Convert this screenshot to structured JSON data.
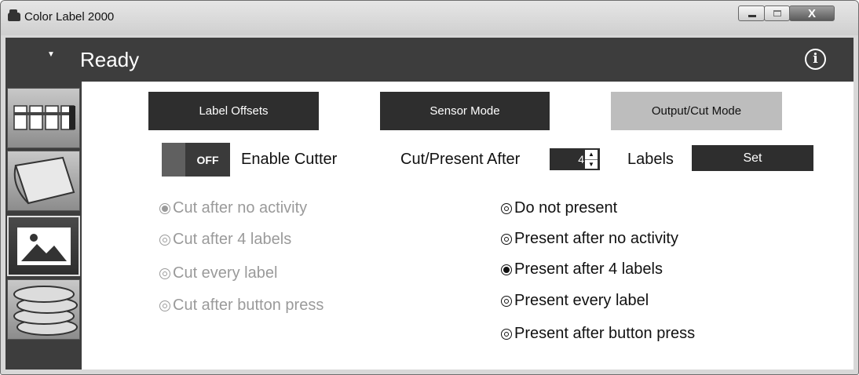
{
  "window": {
    "title": "Color Label 2000",
    "close_glyph": "X"
  },
  "status": {
    "text": "Ready",
    "info_icon": "info-icon"
  },
  "sidebar": {
    "tabs": [
      "printer-cartridge-icon",
      "roll-media-icon",
      "image-icon",
      "coins-icon"
    ]
  },
  "tabs": [
    {
      "label": "Label Offsets"
    },
    {
      "label": "Sensor Mode"
    },
    {
      "label": "Output/Cut Mode"
    }
  ],
  "cutter": {
    "toggle_state": "OFF",
    "label": "Enable Cutter"
  },
  "cut_present": {
    "label": "Cut/Present After",
    "count": "4",
    "unit_label": "Labels",
    "set_label": "Set"
  },
  "cut_options": [
    {
      "label": "Cut after no activity",
      "selected": true
    },
    {
      "label": "Cut after 4 labels",
      "selected": false
    },
    {
      "label": "Cut every label",
      "selected": false
    },
    {
      "label": "Cut after button press",
      "selected": false
    }
  ],
  "present_options": [
    {
      "label": "Do not present",
      "selected": false
    },
    {
      "label": "Present after no activity",
      "selected": false
    },
    {
      "label": "Present after 4 labels",
      "selected": true
    },
    {
      "label": "Present every label",
      "selected": false
    },
    {
      "label": "Present after button press",
      "selected": false
    }
  ],
  "colors": {
    "dark": "#2e2e2e",
    "active_tab": "#bdbdbd",
    "status_bar": "#3d3d3d",
    "disabled_text": "#9a9a9a"
  }
}
